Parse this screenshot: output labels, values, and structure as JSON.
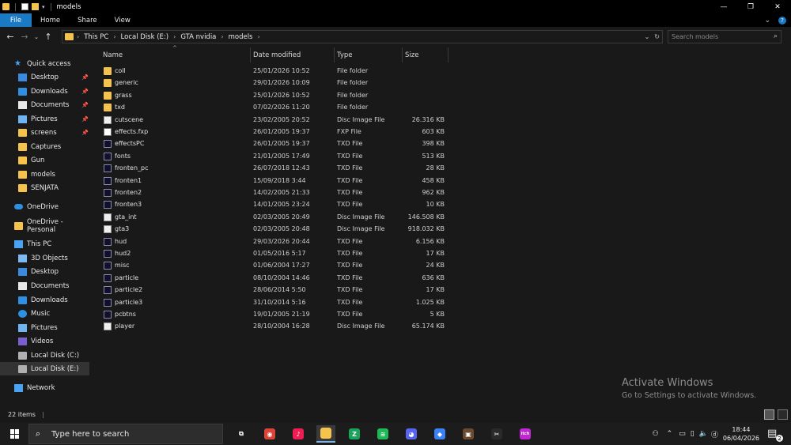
{
  "window": {
    "title": "models",
    "controls": {
      "minimize": "—",
      "restore": "❐",
      "close": "✕"
    }
  },
  "ribbon": {
    "tabs": [
      "File",
      "Home",
      "Share",
      "View"
    ],
    "expand_glyph": "⌄",
    "help_glyph": "?"
  },
  "address": {
    "crumbs": [
      "This PC",
      "Local Disk (E:)",
      "GTA nvidia",
      "models"
    ],
    "dropdown_glyph": "⌄",
    "refresh_glyph": "↻"
  },
  "search": {
    "placeholder": "Search models",
    "icon": "search-icon"
  },
  "nav": {
    "quick_access": "Quick access",
    "pinned": [
      "Desktop",
      "Downloads",
      "Documents",
      "Pictures",
      "screens"
    ],
    "recent": [
      "Captures",
      "Gun",
      "models",
      "SENJATA"
    ],
    "onedrive": "OneDrive",
    "onedrive_personal": "OneDrive - Personal",
    "this_pc": "This PC",
    "pc_items": [
      "3D Objects",
      "Desktop",
      "Documents",
      "Downloads",
      "Music",
      "Pictures",
      "Videos",
      "Local Disk (C:)",
      "Local Disk (E:)"
    ],
    "network": "Network"
  },
  "columns": {
    "name": "Name",
    "date": "Date modified",
    "type": "Type",
    "size": "Size"
  },
  "files": [
    {
      "name": "coll",
      "date": "25/01/2026 10:52",
      "type": "File folder",
      "size": "",
      "kind": "folder"
    },
    {
      "name": "generic",
      "date": "29/01/2026 10:09",
      "type": "File folder",
      "size": "",
      "kind": "folder"
    },
    {
      "name": "grass",
      "date": "25/01/2026 10:52",
      "type": "File folder",
      "size": "",
      "kind": "folder"
    },
    {
      "name": "txd",
      "date": "07/02/2026 11:20",
      "type": "File folder",
      "size": "",
      "kind": "folder"
    },
    {
      "name": "cutscene",
      "date": "23/02/2005 20:52",
      "type": "Disc Image File",
      "size": "26.316 KB",
      "kind": "file"
    },
    {
      "name": "effects.fxp",
      "date": "26/01/2005 19:37",
      "type": "FXP File",
      "size": "603 KB",
      "kind": "fxp"
    },
    {
      "name": "effectsPC",
      "date": "26/01/2005 19:37",
      "type": "TXD File",
      "size": "398 KB",
      "kind": "txd"
    },
    {
      "name": "fonts",
      "date": "21/01/2005 17:49",
      "type": "TXD File",
      "size": "513 KB",
      "kind": "txd"
    },
    {
      "name": "fronten_pc",
      "date": "26/07/2018 12:43",
      "type": "TXD File",
      "size": "28 KB",
      "kind": "txd"
    },
    {
      "name": "fronten1",
      "date": "15/09/2018 3:44",
      "type": "TXD File",
      "size": "458 KB",
      "kind": "txd"
    },
    {
      "name": "fronten2",
      "date": "14/02/2005 21:33",
      "type": "TXD File",
      "size": "962 KB",
      "kind": "txd"
    },
    {
      "name": "fronten3",
      "date": "14/01/2005 23:24",
      "type": "TXD File",
      "size": "10 KB",
      "kind": "txd"
    },
    {
      "name": "gta_int",
      "date": "02/03/2005 20:49",
      "type": "Disc Image File",
      "size": "146.508 KB",
      "kind": "file"
    },
    {
      "name": "gta3",
      "date": "02/03/2005 20:48",
      "type": "Disc Image File",
      "size": "918.032 KB",
      "kind": "file"
    },
    {
      "name": "hud",
      "date": "29/03/2026 20:44",
      "type": "TXD File",
      "size": "6.156 KB",
      "kind": "txd"
    },
    {
      "name": "hud2",
      "date": "01/05/2016 5:17",
      "type": "TXD File",
      "size": "17 KB",
      "kind": "txd"
    },
    {
      "name": "misc",
      "date": "01/06/2004 17:27",
      "type": "TXD File",
      "size": "24 KB",
      "kind": "txd"
    },
    {
      "name": "particle",
      "date": "08/10/2004 14:46",
      "type": "TXD File",
      "size": "636 KB",
      "kind": "txd"
    },
    {
      "name": "particle2",
      "date": "28/06/2014 5:50",
      "type": "TXD File",
      "size": "17 KB",
      "kind": "txd"
    },
    {
      "name": "particle3",
      "date": "31/10/2014 5:16",
      "type": "TXD File",
      "size": "1.025 KB",
      "kind": "txd"
    },
    {
      "name": "pcbtns",
      "date": "19/01/2005 21:19",
      "type": "TXD File",
      "size": "5 KB",
      "kind": "txd"
    },
    {
      "name": "player",
      "date": "28/10/2004 16:28",
      "type": "Disc Image File",
      "size": "65.174 KB",
      "kind": "file"
    }
  ],
  "status": {
    "count": "22 items"
  },
  "watermark": {
    "line1": "Activate Windows",
    "line2": "Go to Settings to activate Windows."
  },
  "taskbar": {
    "search_placeholder": "Type here to search",
    "apps": [
      {
        "name": "task-view",
        "color": "#1c1c1c",
        "glyph": "⧉"
      },
      {
        "name": "chrome",
        "color": "#db4437",
        "glyph": "◉"
      },
      {
        "name": "tiktok",
        "color": "#ee1d52",
        "glyph": "♪"
      },
      {
        "name": "file-explorer",
        "color": "#f4c24d",
        "glyph": ""
      },
      {
        "name": "app-green",
        "color": "#1aa35a",
        "glyph": "Z"
      },
      {
        "name": "spotify",
        "color": "#1db954",
        "glyph": "≋"
      },
      {
        "name": "discord",
        "color": "#5865f2",
        "glyph": "◕"
      },
      {
        "name": "roblox",
        "color": "#3b82f6",
        "glyph": "◆"
      },
      {
        "name": "game-app",
        "color": "#6b4a2f",
        "glyph": "▣"
      },
      {
        "name": "capcut",
        "color": "#2a2a2a",
        "glyph": "✂"
      },
      {
        "name": "itch-app",
        "color": "#c026d3",
        "glyph": "itch"
      }
    ],
    "time": "18:44",
    "date": "06/04/2026",
    "notif_count": "2"
  },
  "colors": {
    "accent": "#1a7ac4",
    "folder": "#f4c24d",
    "bg": "#191919"
  }
}
